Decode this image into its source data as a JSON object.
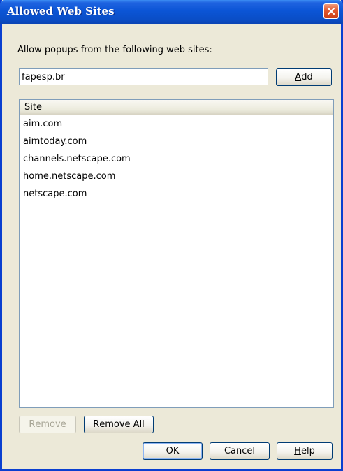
{
  "window": {
    "title": "Allowed Web Sites"
  },
  "instruction": "Allow popups from the following web sites:",
  "site_input": {
    "value": "fapesp.br"
  },
  "buttons": {
    "add": {
      "prefix": "",
      "accel": "A",
      "rest": "dd"
    },
    "remove": {
      "prefix": "",
      "accel": "R",
      "rest": "emove",
      "enabled": false
    },
    "remove_all": {
      "prefix": "R",
      "accel": "e",
      "rest": "move All"
    },
    "ok": {
      "label": "OK"
    },
    "cancel": {
      "label": "Cancel"
    },
    "help": {
      "prefix": "",
      "accel": "H",
      "rest": "elp"
    }
  },
  "list": {
    "column_header": "Site",
    "sites": [
      "aim.com",
      "aimtoday.com",
      "channels.netscape.com",
      "home.netscape.com",
      "netscape.com"
    ]
  }
}
